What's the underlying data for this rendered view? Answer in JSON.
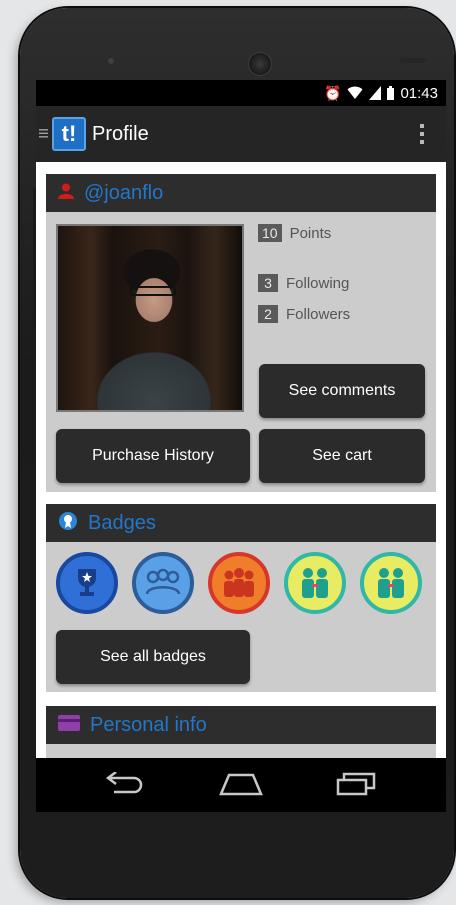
{
  "status_bar": {
    "time": "01:43",
    "alarm_icon": "alarm-icon",
    "wifi_icon": "wifi-icon",
    "signal_icon": "signal-icon",
    "battery_icon": "battery-icon"
  },
  "action_bar": {
    "title": "Profile",
    "logo_text": "t!"
  },
  "profile": {
    "username": "@joanflo",
    "points_count": "10",
    "points_label": "Points",
    "following_count": "3",
    "following_label": "Following",
    "followers_count": "2",
    "followers_label": "Followers",
    "see_comments": "See comments",
    "purchase_history": "Purchase History",
    "see_cart": "See cart"
  },
  "badges": {
    "title": "Badges",
    "see_all": "See all badges",
    "items": [
      {
        "icon": "trophy-icon",
        "color": "#2f6fd6",
        "ring": "#1a47a0"
      },
      {
        "icon": "group-ribbon-icon",
        "color": "#5aa0e6",
        "ring": "#2d5c98"
      },
      {
        "icon": "group-icon",
        "color": "#f07d2a",
        "ring": "#d9362b"
      },
      {
        "icon": "pair-icon",
        "color": "#e8ec62",
        "ring": "#2fb7a8"
      },
      {
        "icon": "pair-icon",
        "color": "#e8ec62",
        "ring": "#2fb7a8"
      }
    ]
  },
  "personal_info": {
    "title": "Personal info"
  },
  "nav": {
    "back_icon": "back-icon",
    "home_icon": "home-icon",
    "recents_icon": "recents-icon"
  },
  "colors": {
    "accent": "#2277c9",
    "card_bg": "#cccccc",
    "card_header": "#2d2d2d",
    "button": "#2b2b2b"
  }
}
